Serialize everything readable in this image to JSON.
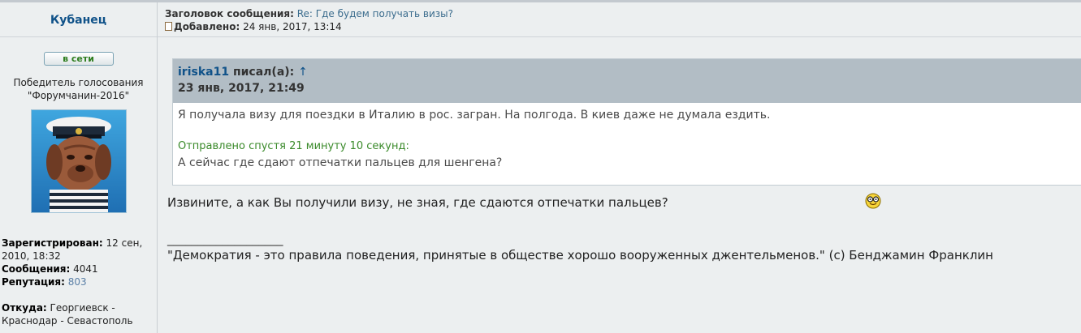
{
  "author": {
    "name": "Кубанец",
    "online_badge": "в сети",
    "rank_line1": "Победитель голосования",
    "rank_line2": "\"Форумчанин-2016\"",
    "avatar_icon": "avatar-dog-sailor",
    "registered_label": "Зарегистрирован:",
    "registered_value": "12 сен, 2010, 18:32",
    "messages_label": "Сообщения:",
    "messages_value": "4041",
    "reputation_label": "Репутация:",
    "reputation_value": "803",
    "location_label": "Откуда:",
    "location_value": "Георгиевск - Краснодар - Севастополь"
  },
  "post": {
    "subject_label": "Заголовок сообщения:",
    "subject_value": "Re: Где будем получать визы?",
    "added_label": "Добавлено:",
    "added_value": "24 янв, 2017, 13:14",
    "quote": {
      "user": "iriska11",
      "wrote": "писал(а):",
      "arrow": "↑",
      "date": "23 янв, 2017, 21:49",
      "text1": "Я получала визу для поездки в Италию в рос. загран. На полгода. В киев даже не думала ездить.",
      "added_note": "Отправлено спустя 21 минуту 10 секунд:",
      "text2": "А сейчас где сдают отпечатки пальцев для шенгена?"
    },
    "reply_text": "Извините, а как Вы получили визу, не зная, где сдаются отпечатки пальцев?",
    "smiley_icon": "smiley-glasses",
    "signature_line": "___________________",
    "signature_text": "\"Демократия - это правила поведения, принятые в обществе хорошо вооруженных джентельменов.\" (c) Бенджамин Франклин"
  }
}
